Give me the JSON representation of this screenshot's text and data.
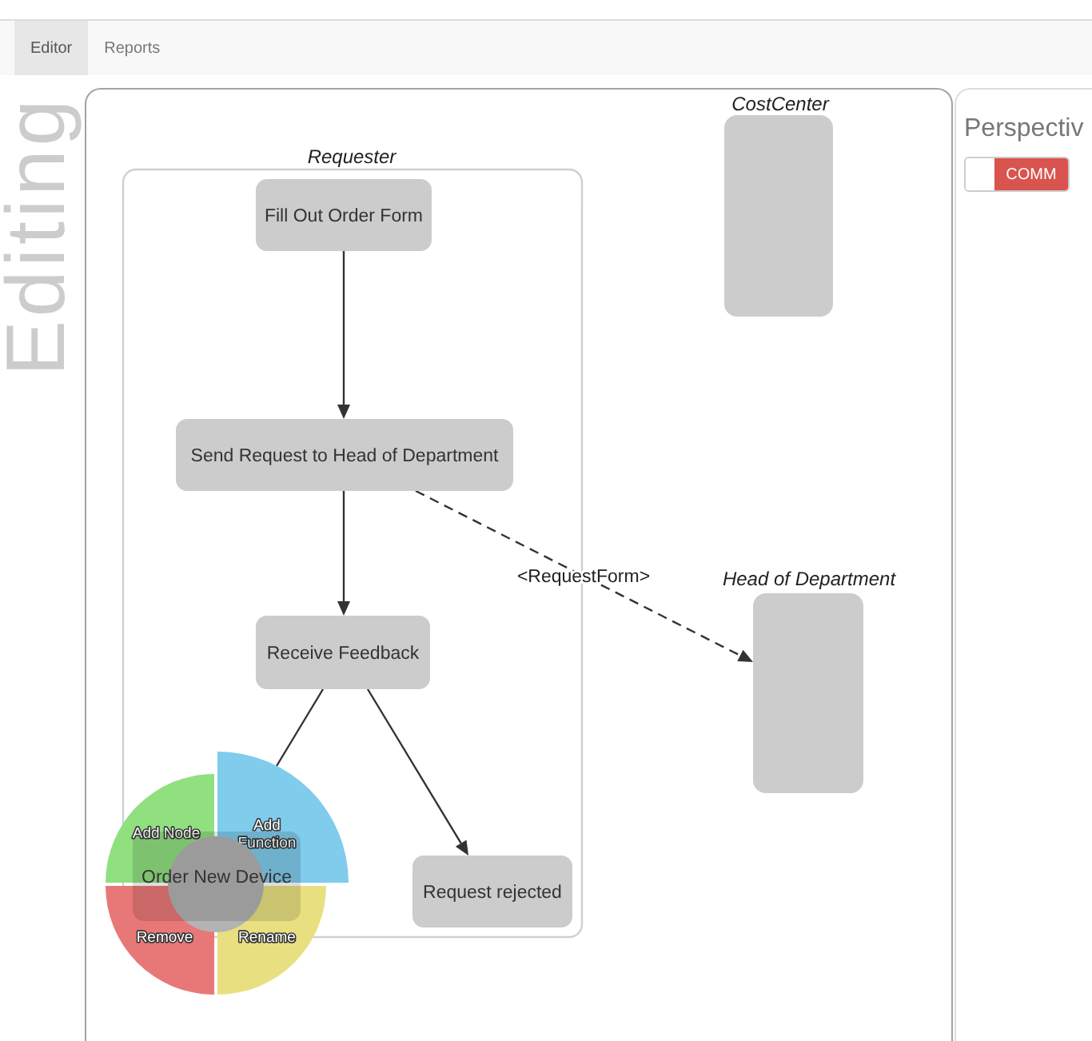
{
  "nav_tabs": [
    {
      "label": "Editor",
      "selected": true
    },
    {
      "label": "Reports",
      "selected": false
    }
  ],
  "mode_label": "Editing",
  "diagram": {
    "lanes": [
      {
        "label": "Requester",
        "collapsed": false
      },
      {
        "label": "CostCenter",
        "collapsed": true
      },
      {
        "label": "Head of Department",
        "collapsed": true
      }
    ],
    "nodes": [
      {
        "label": "Fill Out Order Form"
      },
      {
        "label": "Send Request to Head of Department"
      },
      {
        "label": "Receive Feedback"
      },
      {
        "label": "Request rejected"
      },
      {
        "label": "Order New Device"
      }
    ],
    "edges": [
      {
        "kind": "solid",
        "arrowhead": true
      },
      {
        "kind": "solid",
        "arrowhead": true
      },
      {
        "kind": "solid",
        "arrowhead": true
      },
      {
        "kind": "solid",
        "arrowhead": false
      },
      {
        "kind": "dashed",
        "arrowhead": true,
        "label": "<RequestForm>"
      }
    ],
    "radial_menu": {
      "items": [
        {
          "label": "Add Node",
          "color": "#90e080",
          "selected": false
        },
        {
          "label": "Add Function",
          "color": "#80ccec",
          "selected": true
        },
        {
          "label": "Remove",
          "color": "#e87878",
          "selected": false
        },
        {
          "label": "Rename",
          "color": "#e8e080",
          "selected": false
        }
      ]
    }
  },
  "perspective_panel": {
    "title": "Perspectiv",
    "toggle": {
      "label": "COMM",
      "on": false
    }
  }
}
